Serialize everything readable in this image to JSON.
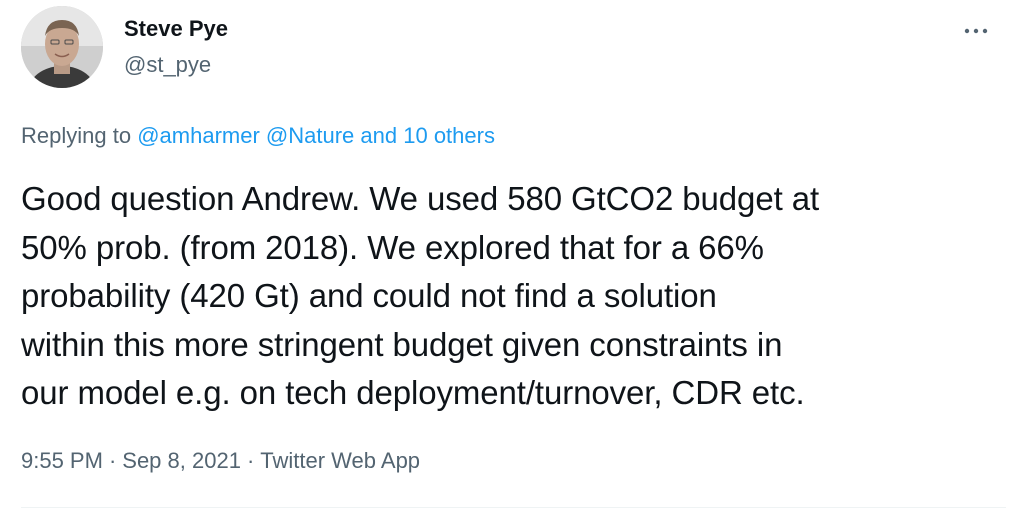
{
  "author": {
    "display_name": "Steve Pye",
    "handle": "@st_pye",
    "avatar_icon": "user-avatar-photo"
  },
  "more_icon": "more-dots-icon",
  "replying": {
    "prefix": "Replying to",
    "mention_1": "@amharmer",
    "mention_2": "@Nature",
    "others": "and 10 others"
  },
  "tweet": {
    "lines": [
      "Good question Andrew. We used 580 GtCO2 budget at",
      "50% prob. (from 2018). We explored that for a 66%",
      "probability (420 Gt) and could not find a solution",
      "within this more stringent budget given constraints in",
      "our model e.g. on tech deployment/turnover, CDR etc."
    ]
  },
  "meta": {
    "time": "9:55 PM",
    "separator": "·",
    "date": "Sep 8, 2021",
    "source": "Twitter Web App"
  },
  "colors": {
    "text": "#0f1419",
    "secondary": "#536471",
    "link": "#1d9bf0",
    "divider": "#eff3f4"
  }
}
